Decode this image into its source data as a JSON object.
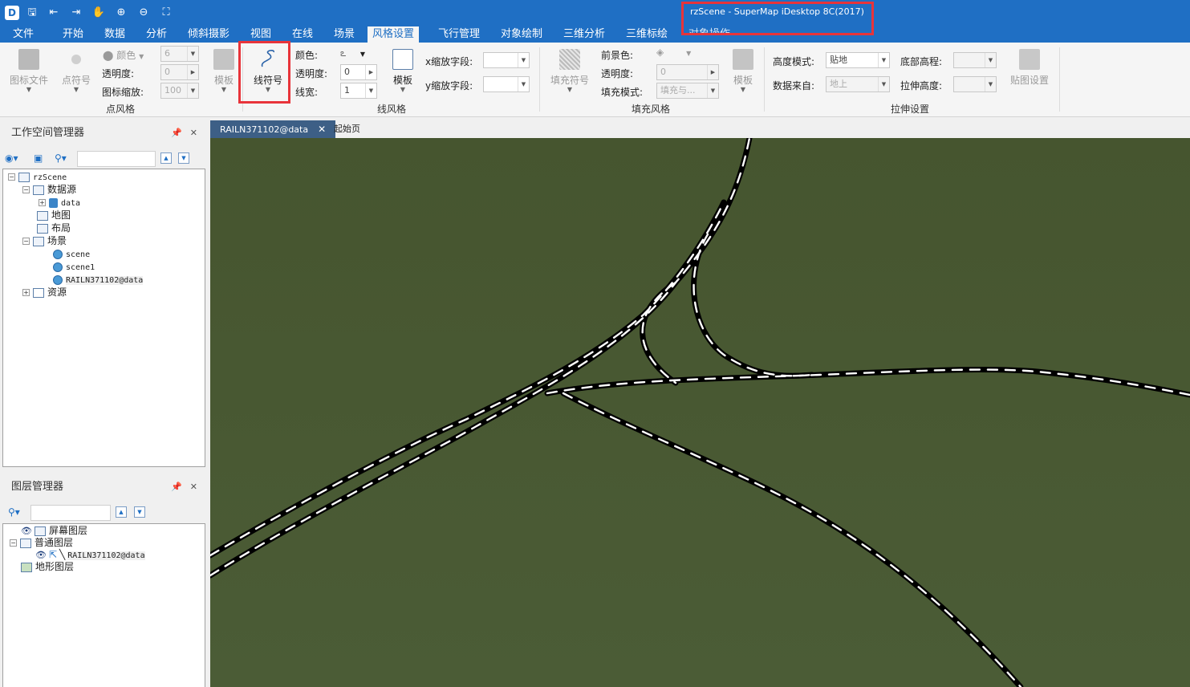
{
  "window": {
    "title": "rzScene - SuperMap iDesktop 8C(2017)"
  },
  "menu": {
    "tabs": [
      "文件",
      "开始",
      "数据",
      "分析",
      "倾斜摄影",
      "视图",
      "在线",
      "场景",
      "风格设置",
      "飞行管理",
      "对象绘制",
      "三维分析",
      "三维标绘",
      "对象操作"
    ],
    "active_index": 8
  },
  "ribbon": {
    "point_style": {
      "group_label": "点风格",
      "icon_file": "图标文件",
      "point_symbol": "点符号",
      "color_label": "颜色",
      "opacity_label": "透明度:",
      "icon_scale_label": "图标缩放:",
      "size_value": "6",
      "opacity_value": "0",
      "scale_value": "100",
      "template": "模板"
    },
    "line_style": {
      "group_label": "线风格",
      "line_symbol": "线符号",
      "color_label": "颜色:",
      "opacity_label": "透明度:",
      "width_label": "线宽:",
      "opacity_value": "0",
      "width_value": "1",
      "template": "模板",
      "x_scale_label": "x缩放字段:",
      "y_scale_label": "y缩放字段:"
    },
    "fill_style": {
      "group_label": "填充风格",
      "fill_symbol": "填充符号",
      "fg_color_label": "前景色:",
      "opacity_label": "透明度:",
      "fill_mode_label": "填充模式:",
      "opacity_value": "0",
      "fill_mode_value": "填充与...",
      "template": "模板"
    },
    "extrude": {
      "group_label": "拉伸设置",
      "height_mode_label": "高度模式:",
      "height_mode_value": "贴地",
      "data_source_label": "数据来自:",
      "data_source_value": "地上",
      "bottom_height_label": "底部高程:",
      "extrude_height_label": "拉伸高度:",
      "texture_setting": "贴图设置"
    }
  },
  "workspace_panel": {
    "title": "工作空间管理器",
    "tree": {
      "root": "rzScene",
      "datasources": "数据源",
      "data": "data",
      "maps": "地图",
      "layouts": "布局",
      "scenes": "场景",
      "scene": "scene",
      "scene1": "scene1",
      "scene_rail": "RAILN371102@data",
      "resources": "资源"
    }
  },
  "layer_panel": {
    "title": "图层管理器",
    "tree": {
      "screen_layers": "屏幕图层",
      "normal_layers": "普通图层",
      "rail_layer": "RAILN371102@data",
      "terrain_layers": "地形图层"
    }
  },
  "doc_tabs": {
    "active": "RAILN371102@data",
    "start": "起始页"
  },
  "icons": {
    "pin": "pin-icon",
    "close": "close-icon"
  }
}
